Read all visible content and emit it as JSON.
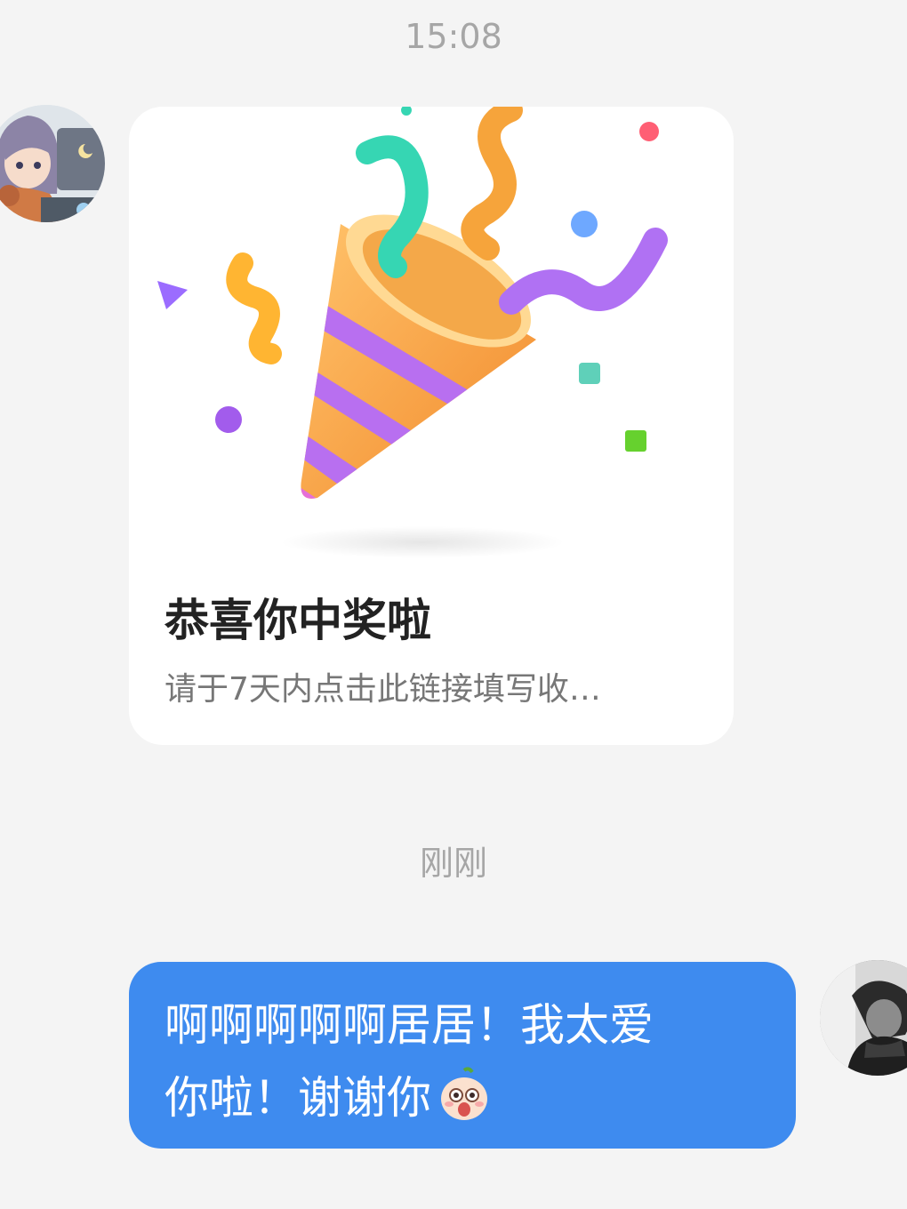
{
  "chat": {
    "timestamp_top": "15:08",
    "timestamp_mid": "刚刚"
  },
  "card": {
    "title": "恭喜你中奖啦",
    "subtitle": "请于7天内点击此链接填写收…",
    "illustration": "party-popper-icon"
  },
  "bubble": {
    "line1": "啊啊啊啊啊居居！我太爱",
    "line2": "你啦！谢谢你",
    "emoji": "surprised-face-emoji"
  },
  "colors": {
    "background": "#f4f4f4",
    "bubble": "#3e8bef",
    "card": "#ffffff",
    "timestamp": "#a6a6a6"
  }
}
